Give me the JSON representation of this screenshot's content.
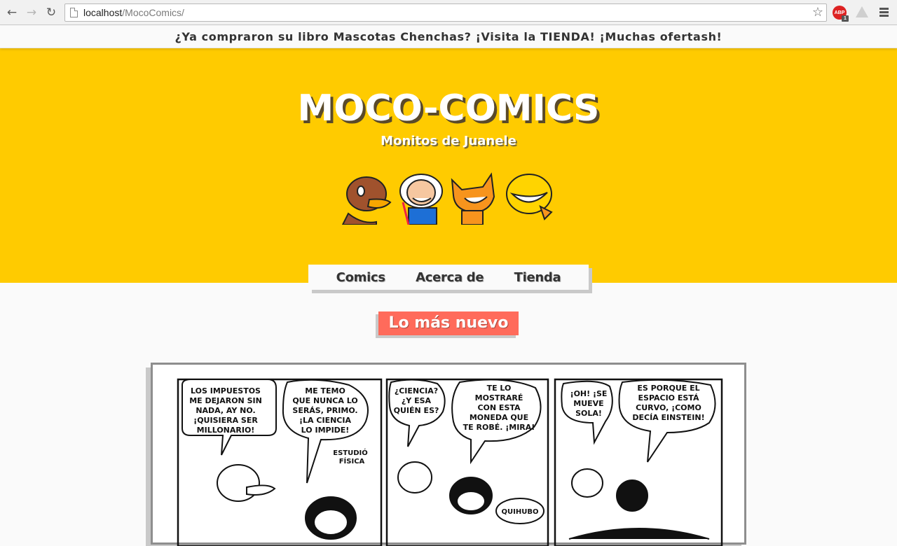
{
  "browser": {
    "url_host": "localhost",
    "url_path": "/MocoComics/",
    "extension_abp_label": "ABP",
    "extension_abp_badge": "1",
    "icons": [
      "back-arrow-icon",
      "forward-arrow-icon",
      "reload-icon",
      "page-icon",
      "star-icon",
      "adblock-icon",
      "drive-icon",
      "menu-icon"
    ]
  },
  "announcement": "¿Ya compraron su libro Mascotas Chenchas? ¡Visita la TIENDA! ¡Muchas ofertash!",
  "header": {
    "title": "MOCO-COMICS",
    "subtitle": "Monitos de Juanele",
    "background_color": "#ffcb00"
  },
  "nav": {
    "items": [
      {
        "label": "Comics"
      },
      {
        "label": "Acerca de"
      },
      {
        "label": "Tienda"
      }
    ]
  },
  "section": {
    "heading": "Lo más nuevo",
    "accent_color": "#ff6b5b"
  },
  "comic": {
    "panels": [
      {
        "balloons": [
          "LOS IMPUESTOS ME DEJARON SIN NADA, AY NO. ¡QUISIERA SER MILLONARIO!",
          "ME TEMO QUE NUNCA LO SERÁS, PRIMO. ¡LA CIENCIA LO IMPIDE!"
        ],
        "caption": "ESTUDIÓ FÍSICA"
      },
      {
        "balloons": [
          "¿CIENCIA? ¿Y ESA QUIÉN ES?",
          "TE LO MOSTRARÉ CON ESTA MONEDA QUE TE ROBÉ. ¡MIRA!"
        ],
        "caption": "QUIHUBO"
      },
      {
        "balloons": [
          "¡OH! ¡SE MUEVE SOLA!",
          "ES PORQUE EL ESPACIO ESTÁ CURVO, ¡COMO DECÍA EINSTEIN!"
        ]
      }
    ]
  }
}
